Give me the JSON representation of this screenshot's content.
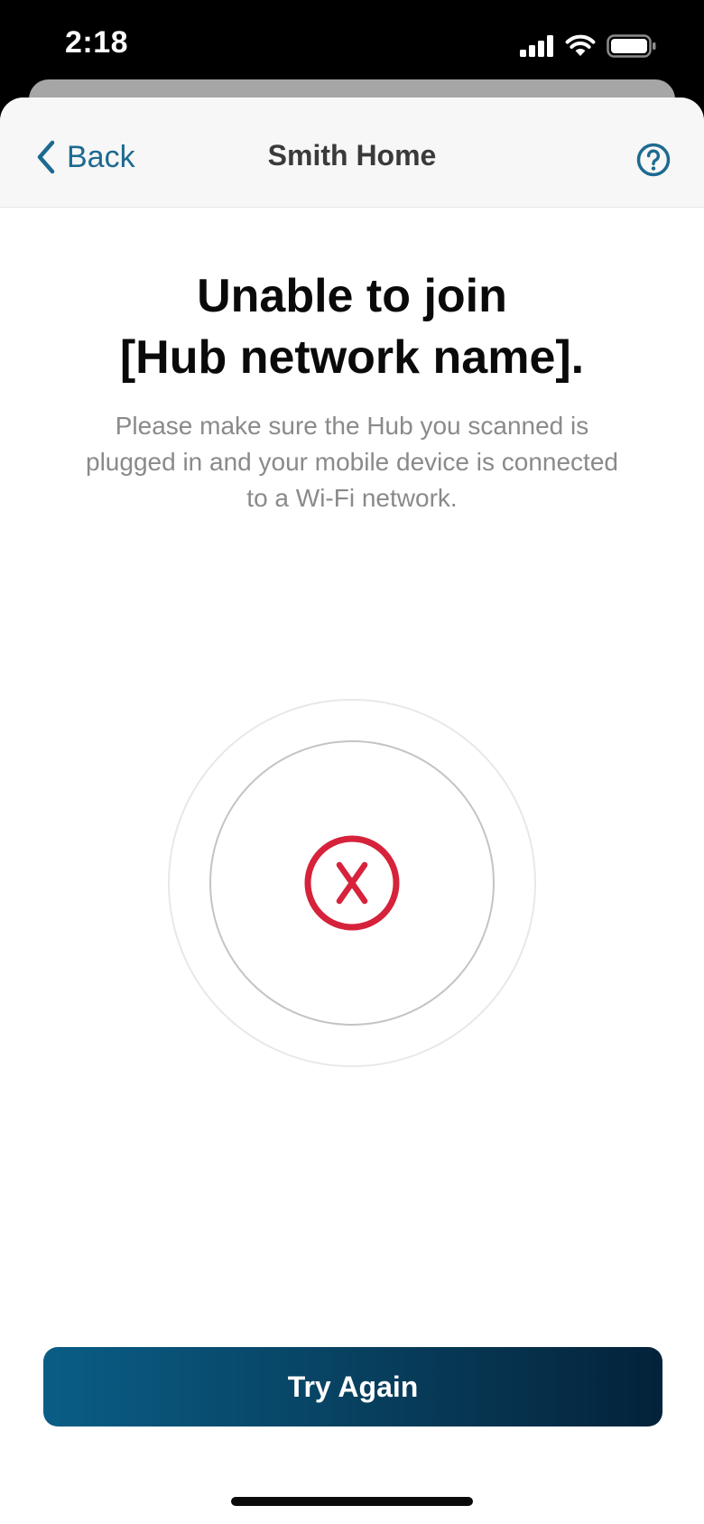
{
  "status_bar": {
    "time": "2:18",
    "icons": [
      "cellular-signal-icon",
      "wifi-icon",
      "battery-icon"
    ]
  },
  "nav": {
    "back_label": "Back",
    "back_icon": "chevron-left-icon",
    "title": "Smith Home",
    "help_icon": "question-circle-icon"
  },
  "main": {
    "headline_line1": "Unable to join",
    "headline_line2": "[Hub network name].",
    "message": "Please make sure the Hub you scanned is plugged in and your mobile device is connected to a Wi-Fi network.",
    "status_icon": "error-x-circle-icon"
  },
  "actions": {
    "primary_label": "Try Again"
  },
  "colors": {
    "accent": "#1d6a91",
    "error": "#d6223a",
    "button_gradient_start": "#0a5d86",
    "button_gradient_end": "#04223a"
  }
}
